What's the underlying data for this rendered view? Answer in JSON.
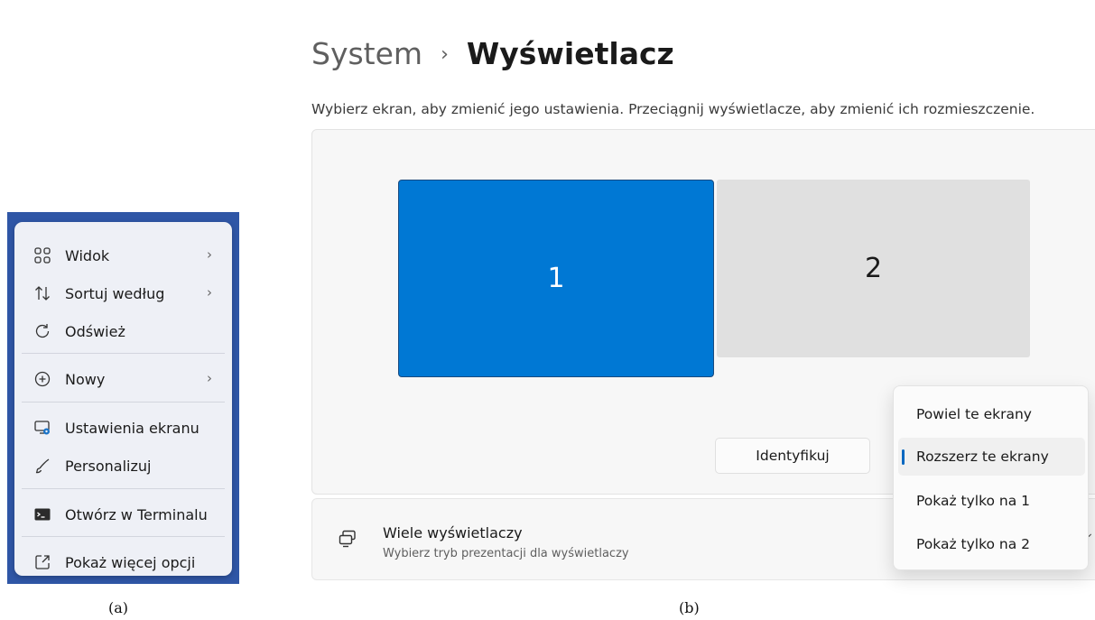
{
  "panel_a": {
    "caption": "(a)",
    "menu": {
      "items": [
        {
          "label": "Widok",
          "icon": "grid-view-icon",
          "submenu": true
        },
        {
          "label": "Sortuj według",
          "icon": "sort-arrows-icon",
          "submenu": true
        },
        {
          "label": "Odśwież",
          "icon": "refresh-icon",
          "submenu": false
        },
        {
          "label": "Nowy",
          "icon": "add-circle-icon",
          "submenu": true
        },
        {
          "label": "Ustawienia ekranu",
          "icon": "display-settings-icon",
          "submenu": false
        },
        {
          "label": "Personalizuj",
          "icon": "brush-icon",
          "submenu": false
        },
        {
          "label": "Otwórz w Terminalu",
          "icon": "terminal-icon",
          "submenu": false
        },
        {
          "label": "Pokaż więcej opcji",
          "icon": "open-external-icon",
          "submenu": false
        }
      ],
      "chevron": "›"
    }
  },
  "panel_b": {
    "caption": "(b)",
    "breadcrumb": {
      "parent": "System",
      "separator": "›",
      "current": "Wyświetlacz"
    },
    "subtitle": "Wybierz ekran, aby zmienić jego ustawienia. Przeciągnij wyświetlacze, aby zmienić ich rozmieszczenie.",
    "monitors": [
      {
        "label": "1",
        "selected": true
      },
      {
        "label": "2",
        "selected": false
      }
    ],
    "identify_button": "Identyfikuj",
    "multi_display": {
      "title": "Wiele wyświetlaczy",
      "description": "Wybierz tryb prezentacji dla wyświetlaczy",
      "icon": "multiple-displays-icon"
    },
    "dropdown": {
      "options": [
        "Powiel te ekrany",
        "Rozszerz te ekrany",
        "Pokaż tylko na 1",
        "Pokaż tylko na 2"
      ],
      "selected_index": 1
    },
    "colors": {
      "accent": "#0078d4",
      "indicator": "#0067c0",
      "secondary_monitor": "#e0e0e0"
    }
  }
}
